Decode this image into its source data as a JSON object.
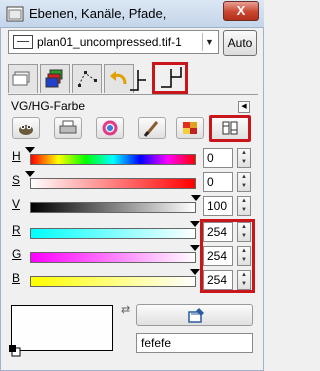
{
  "window": {
    "title": "Ebenen, Kanäle, Pfade, ...",
    "close_label": "X"
  },
  "image_selector": {
    "value": "plan01_uncompressed.tif-1",
    "auto_label": "Auto"
  },
  "tabs": [
    {
      "name": "layers",
      "icon": "layers-icon"
    },
    {
      "name": "channels",
      "icon": "channels-icon"
    },
    {
      "name": "paths",
      "icon": "paths-icon"
    },
    {
      "name": "undo-history",
      "icon": "undo-icon"
    },
    {
      "name": "unknown",
      "icon": "bracket-icon"
    },
    {
      "name": "fg-bg-color",
      "icon": "bracket-icon",
      "active": true
    }
  ],
  "section": {
    "title": "VG/HG-Farbe"
  },
  "tools": [
    {
      "name": "gimp-selector",
      "icon": "wilber-icon"
    },
    {
      "name": "cmyk-selector",
      "icon": "printer-icon"
    },
    {
      "name": "wheel-selector",
      "icon": "color-wheel-icon"
    },
    {
      "name": "watercolor-selector",
      "icon": "brush-icon"
    },
    {
      "name": "palette-selector",
      "icon": "palette-icon"
    },
    {
      "name": "scales-selector",
      "icon": "scales-icon",
      "selected": true
    }
  ],
  "sliders": [
    {
      "label": "H",
      "value": "0",
      "fraction": 0.0
    },
    {
      "label": "S",
      "value": "0",
      "fraction": 0.0
    },
    {
      "label": "V",
      "value": "100",
      "fraction": 1.0
    },
    {
      "label": "R",
      "value": "254",
      "fraction": 0.996
    },
    {
      "label": "G",
      "value": "254",
      "fraction": 0.996
    },
    {
      "label": "B",
      "value": "254",
      "fraction": 0.996
    }
  ],
  "color": {
    "foreground": "#fefefe",
    "hex_value": "fefefe"
  },
  "colors": {
    "accent_red": "#c8161b",
    "title_bar": "#c4d5ea"
  }
}
